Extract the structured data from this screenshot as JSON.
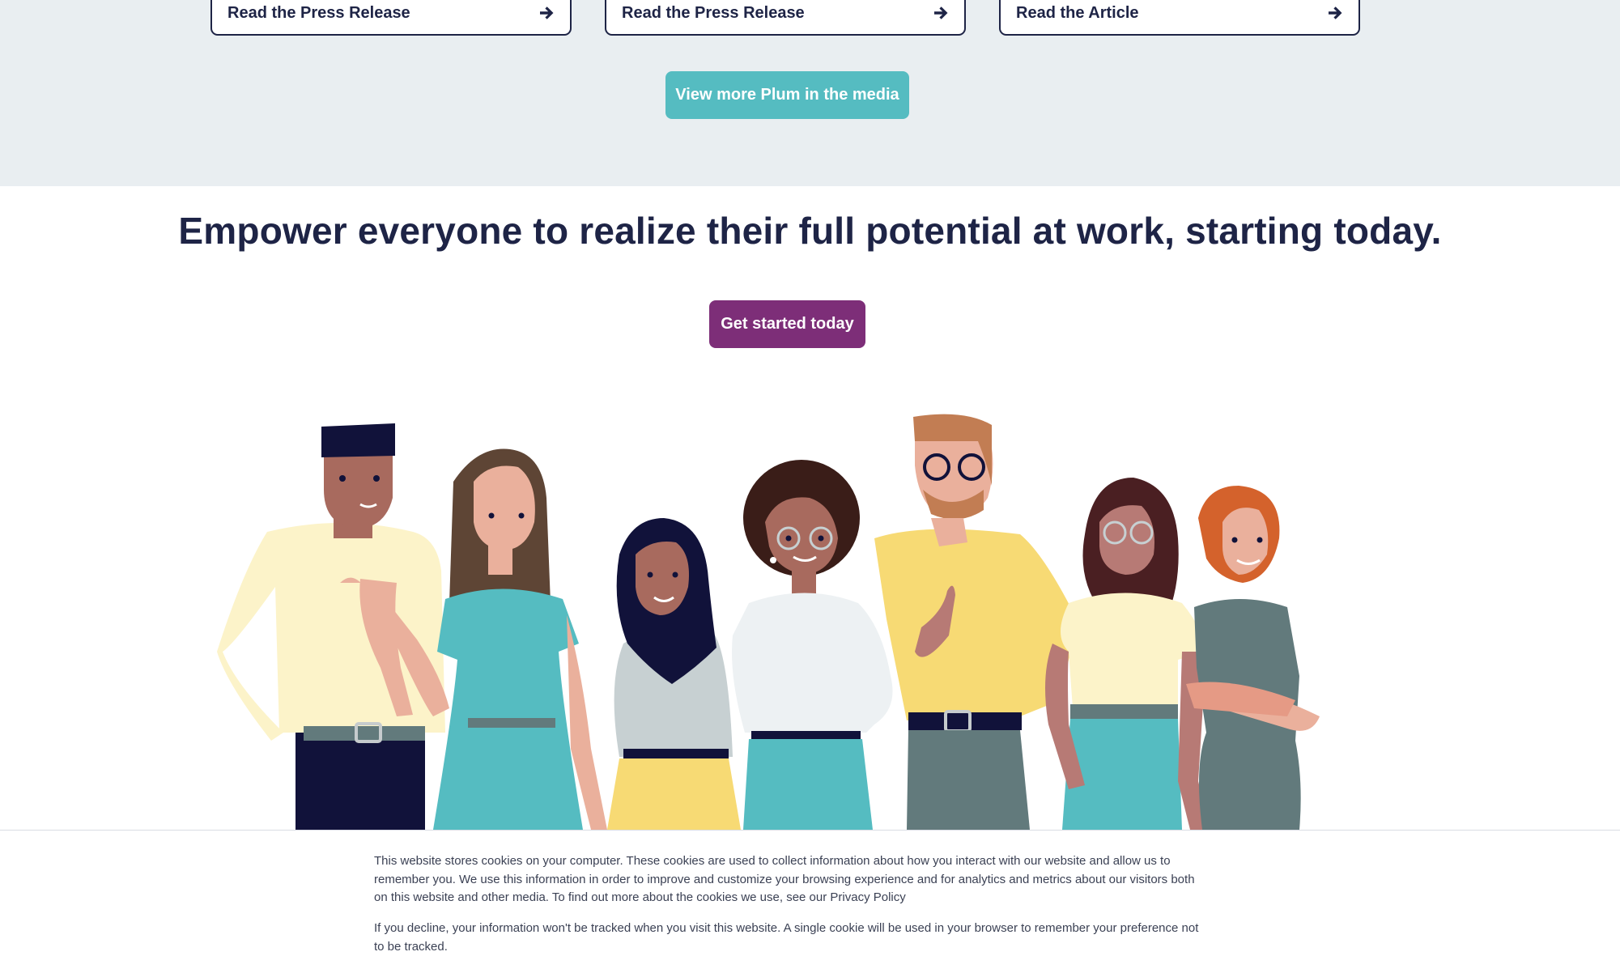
{
  "media_section": {
    "cards": [
      {
        "label": "Read the Press Release",
        "icon": "arrow-right-icon"
      },
      {
        "label": "Read the Press Release",
        "icon": "arrow-right-icon"
      },
      {
        "label": "Read the Article",
        "icon": "arrow-right-icon"
      }
    ],
    "view_more_label": "View more Plum in the media"
  },
  "cta": {
    "headline": "Empower everyone to realize their full potential at work, starting today.",
    "button_label": "Get started today"
  },
  "illustration": {
    "name": "group-of-seven-people"
  },
  "cookie_banner": {
    "paragraph_1": "This website stores cookies on your computer. These cookies are used to collect information about how you interact with our website and allow us to remember you. We use this information in order to improve and customize your browsing experience and for analytics and metrics about our visitors both on this website and other media. To find out more about the cookies we use, see our Privacy Policy",
    "paragraph_2": "If you decline, your information won't be tracked when you visit this website. A single cookie will be used in your browser to remember your preference not to be tracked."
  },
  "colors": {
    "navy": "#1e2446",
    "teal": "#55bcc1",
    "plum": "#7d2e78",
    "band_bg": "#e9eef1"
  }
}
